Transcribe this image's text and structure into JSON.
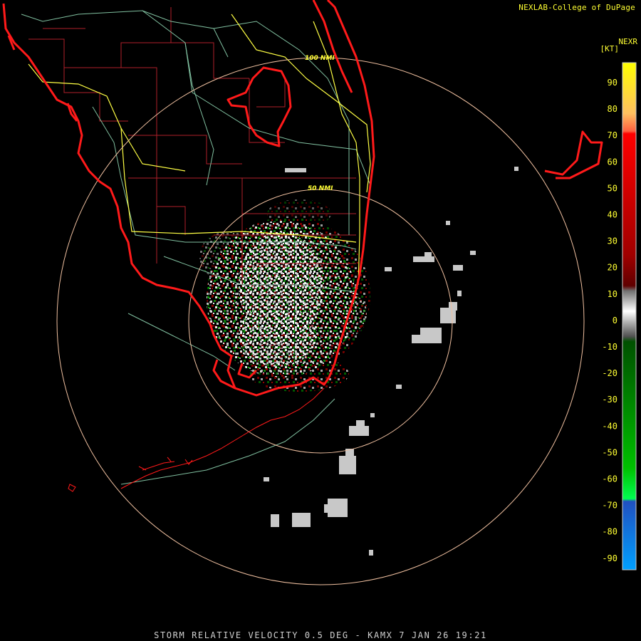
{
  "header": {
    "credit": "NEXLAB-College of DuPage",
    "product": "NEXR",
    "unit": "[KT]"
  },
  "footer": {
    "caption": "STORM RELATIVE VELOCITY 0.5 DEG - KAMX 7 JAN 26 19:21"
  },
  "rings": [
    {
      "label": "50 NMI",
      "range_nmi": 50
    },
    {
      "label": "100 NMI",
      "range_nmi": 100
    }
  ],
  "legend": {
    "ticks": [
      "90",
      "80",
      "70",
      "60",
      "50",
      "40",
      "30",
      "20",
      "10",
      "0",
      "-10",
      "-20",
      "-30",
      "-40",
      "-50",
      "-60",
      "-70",
      "-80",
      "-90"
    ],
    "colors": {
      "outbound_high": "#ffff00",
      "outbound_mid": "#ff0000",
      "outbound_low": "#6a0000",
      "near_zero": "#d0d0d0",
      "inbound_low": "#006400",
      "inbound_mid": "#00e000",
      "inbound_high": "#2060ff"
    }
  },
  "map_colors": {
    "coast": "#ff1a1a",
    "county": "#b0202a",
    "highway": "#ffff44",
    "road": "#80c0a0",
    "ring": "#f0c0a0"
  }
}
